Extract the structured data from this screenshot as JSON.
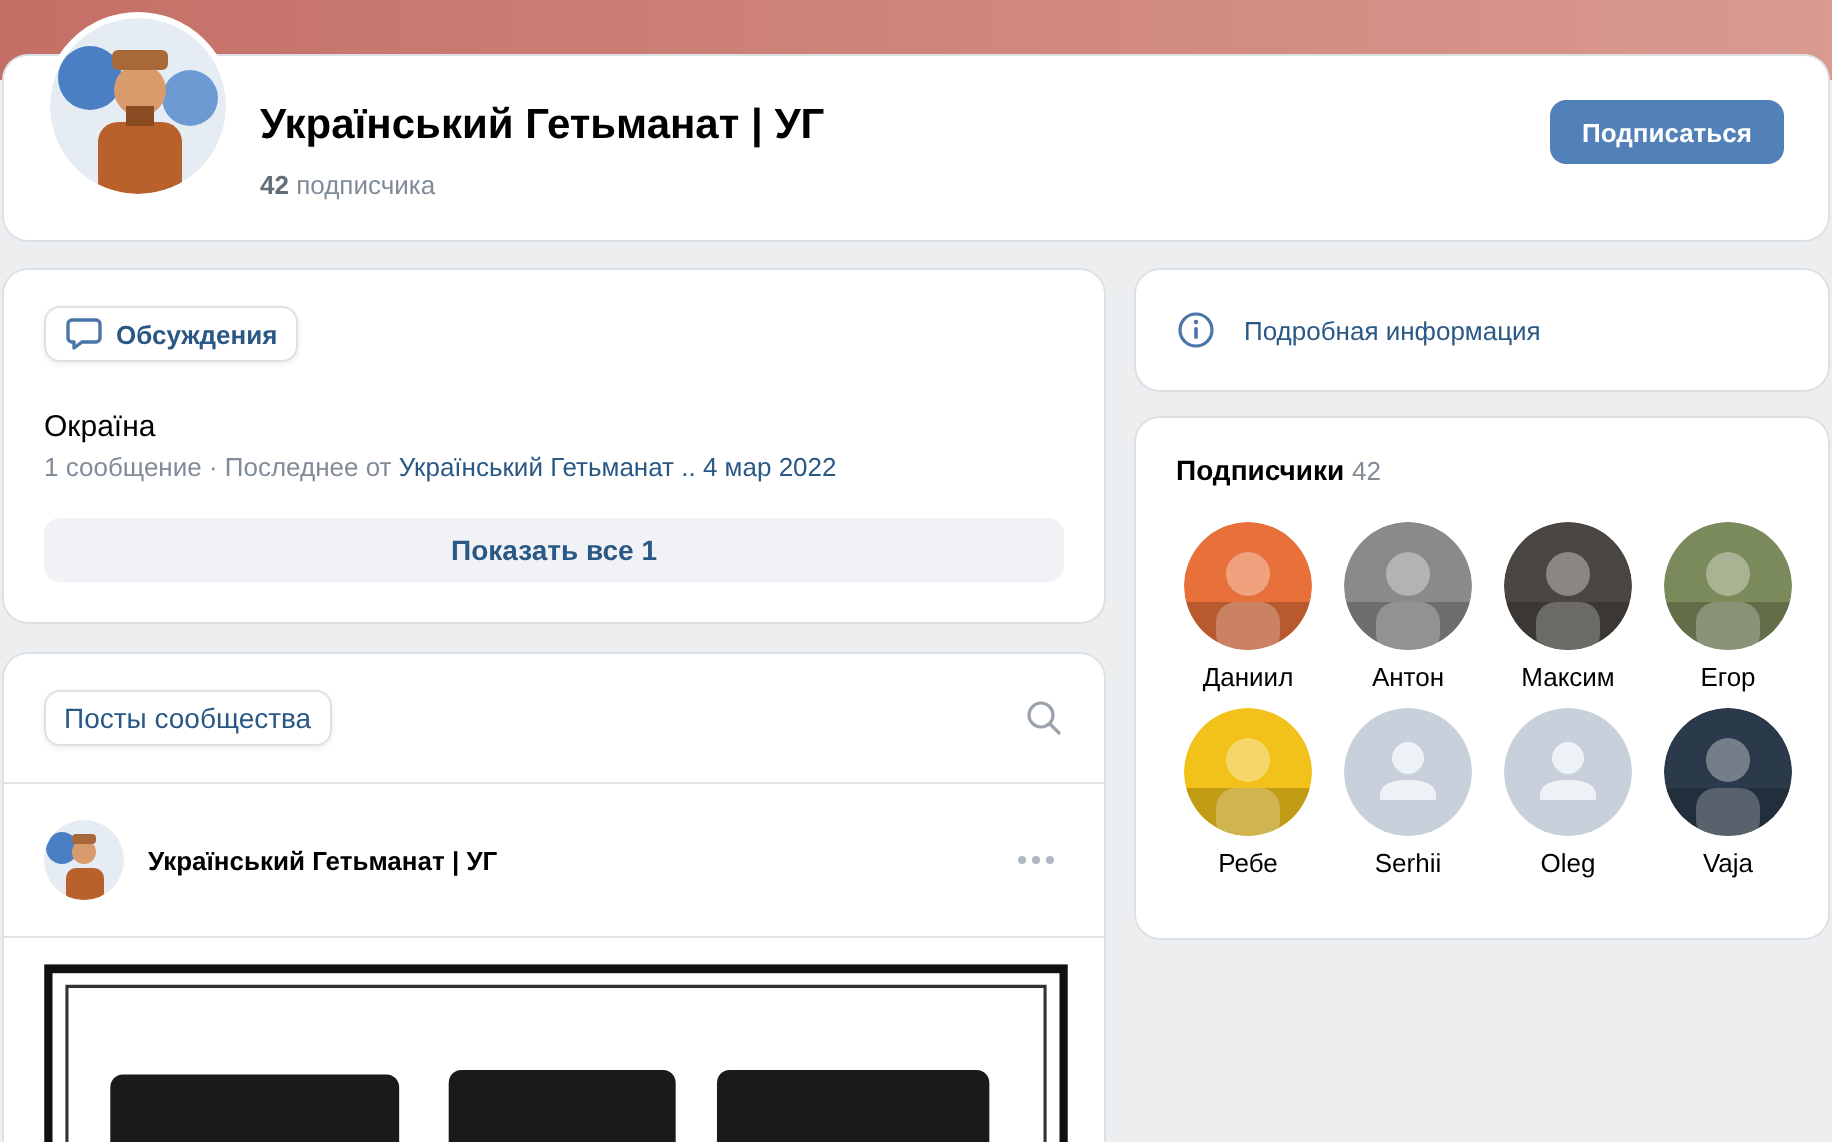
{
  "group": {
    "name": "Український Гетьманат | УГ",
    "subscribers_count": "42",
    "subscribers_label": "подписчика",
    "subscribe_button": "Подписаться"
  },
  "discussions": {
    "tab": "Обсуждения",
    "topics": [
      {
        "title": "Окраїна",
        "meta": "1 сообщение · Последнее от",
        "author": "Український Гетьманат ..",
        "date": "4 мар 2022"
      }
    ],
    "show_all": "Показать все 1"
  },
  "posts": {
    "tab": "Посты сообщества",
    "post": {
      "author": "Український Гетьманат | УГ",
      "kind": "picture"
    }
  },
  "info": {
    "label": "Подробная информация"
  },
  "subscribers": {
    "title": "Подписчики",
    "count": "42",
    "people": [
      {
        "name": "Даниил",
        "color": "#e8703a"
      },
      {
        "name": "Антон",
        "color": "#8a8a8a"
      },
      {
        "name": "Максим",
        "color": "#4a4642"
      },
      {
        "name": "Егор",
        "color": "#7a8a5a"
      },
      {
        "name": "Ребе",
        "color": "#f2c21a"
      },
      {
        "name": "Serhii",
        "kind": "default",
        "color": "#c8d0dc"
      },
      {
        "name": "Oleg",
        "kind": "default",
        "color": "#c8d0dc"
      },
      {
        "name": "Vaja",
        "color": "#2a3a4a"
      }
    ]
  }
}
